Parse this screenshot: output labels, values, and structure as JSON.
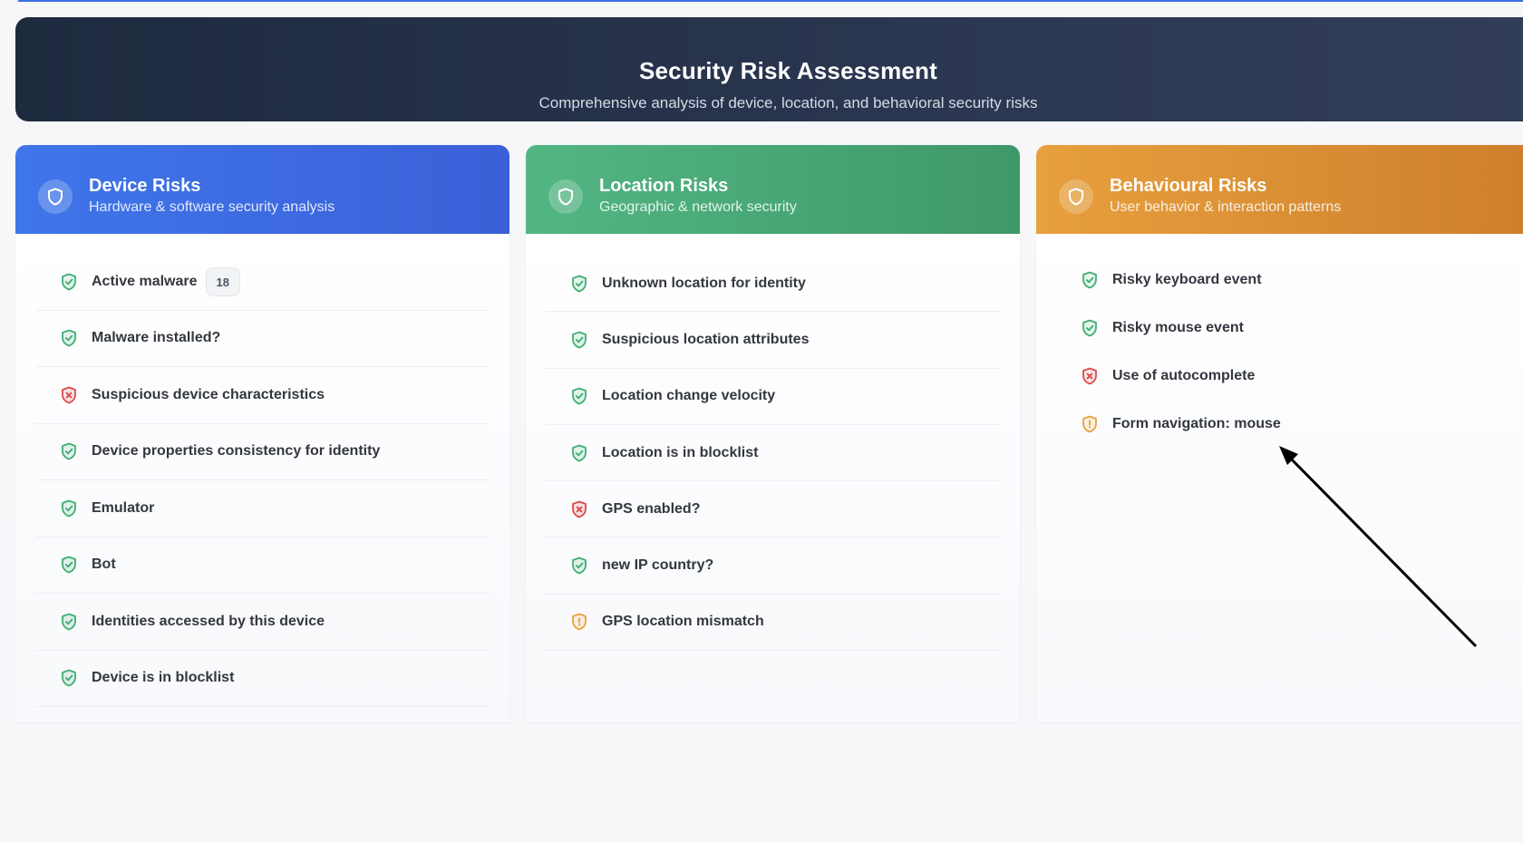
{
  "header": {
    "title": "Security Risk Assessment",
    "subtitle": "Comprehensive analysis of device, location, and behavioral security risks"
  },
  "colors": {
    "pass": "#3fae72",
    "fail": "#e04848",
    "warn": "#eba13a"
  },
  "cards": {
    "device": {
      "title": "Device Risks",
      "subtitle": "Hardware & software security analysis",
      "icon": "shield-icon",
      "items": [
        {
          "label": "Active malware",
          "status": "pass",
          "badge": "18"
        },
        {
          "label": "Malware installed?",
          "status": "pass"
        },
        {
          "label": "Suspicious device characteristics",
          "status": "fail"
        },
        {
          "label": "Device properties consistency for identity",
          "status": "pass"
        },
        {
          "label": "Emulator",
          "status": "pass"
        },
        {
          "label": "Bot",
          "status": "pass"
        },
        {
          "label": "Identities accessed by this device",
          "status": "pass"
        },
        {
          "label": "Device is in blocklist",
          "status": "pass"
        }
      ]
    },
    "location": {
      "title": "Location Risks",
      "subtitle": "Geographic & network security",
      "icon": "shield-icon",
      "items": [
        {
          "label": "Unknown location for identity",
          "status": "pass"
        },
        {
          "label": "Suspicious location attributes",
          "status": "pass"
        },
        {
          "label": "Location change velocity",
          "status": "pass"
        },
        {
          "label": "Location is in blocklist",
          "status": "pass"
        },
        {
          "label": "GPS enabled?",
          "status": "fail"
        },
        {
          "label": "new IP country?",
          "status": "pass"
        },
        {
          "label": "GPS location mismatch",
          "status": "warn"
        }
      ]
    },
    "behaviour": {
      "title": "Behavioural Risks",
      "subtitle": "User behavior & interaction patterns",
      "icon": "shield-icon",
      "items": [
        {
          "label": "Risky keyboard event",
          "status": "pass"
        },
        {
          "label": "Risky mouse event",
          "status": "pass"
        },
        {
          "label": "Use of autocomplete",
          "status": "fail"
        },
        {
          "label": "Form navigation: mouse",
          "status": "warn"
        }
      ]
    }
  }
}
